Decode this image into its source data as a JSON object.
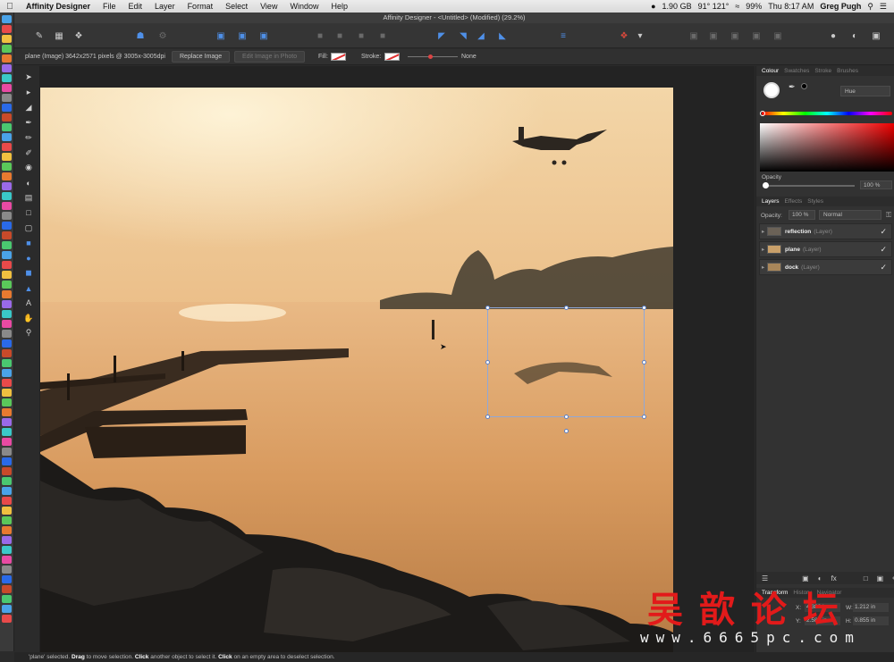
{
  "menubar": {
    "app_name": "Affinity Designer",
    "items": [
      "File",
      "Edit",
      "Layer",
      "Format",
      "Select",
      "View",
      "Window",
      "Help"
    ],
    "memory": "1.90 GB",
    "temperature": "91° 121°",
    "battery": "99%",
    "clock": "Thu 8:17 AM",
    "user": "Greg Pugh"
  },
  "window": {
    "title": "Affinity Designer - <Untitled> (Modified) (29.2%)"
  },
  "context_bar": {
    "selection_info": "plane (Image)   3642x2571 pixels @ 3005x-3005dpi",
    "replace_image": "Replace Image",
    "edit_in_photo": "Edit Image in Photo",
    "fill_label": "Fill:",
    "stroke_label": "Stroke:",
    "stroke_value": "None"
  },
  "colour_panel": {
    "tabs": [
      "Colour",
      "Swatches",
      "Stroke",
      "Brushes"
    ],
    "mode": "Hue",
    "opacity_label": "Opacity",
    "opacity_value": "100 %"
  },
  "layers_panel": {
    "tabs": [
      "Layers",
      "Effects",
      "Styles"
    ],
    "opacity_label": "Opacity:",
    "opacity_value": "100 %",
    "blend_mode": "Normal",
    "layers": [
      {
        "name": "reflection",
        "kind": "(Layer)",
        "thumb": "#6b6257"
      },
      {
        "name": "plane",
        "kind": "(Layer)",
        "thumb": "#c9a06a"
      },
      {
        "name": "dock",
        "kind": "(Layer)",
        "thumb": "#a8865a"
      }
    ]
  },
  "transform_panel": {
    "tabs": [
      "Transform",
      "History",
      "Navigator"
    ],
    "x_label": "X:",
    "x_value": "4.388 in",
    "y_label": "Y:",
    "y_value": "2.581 in",
    "w_label": "W:",
    "w_value": "1.212 in",
    "h_label": "H:",
    "h_value": "0.855 in"
  },
  "status_bar": {
    "lead": "'plane' selected.",
    "drag": "Drag",
    "drag_text": "to move selection.",
    "click": "Click",
    "click_text": "another object to select it.",
    "click2": "Click",
    "click2_text": "on an empty area to deselect selection."
  },
  "watermark": {
    "chinese": "吴歆论坛",
    "url": "www.6665pc.com"
  },
  "colors": {
    "accent": "#4f90e8",
    "panel_bg": "#323232",
    "toolbar_bg": "#353535"
  }
}
